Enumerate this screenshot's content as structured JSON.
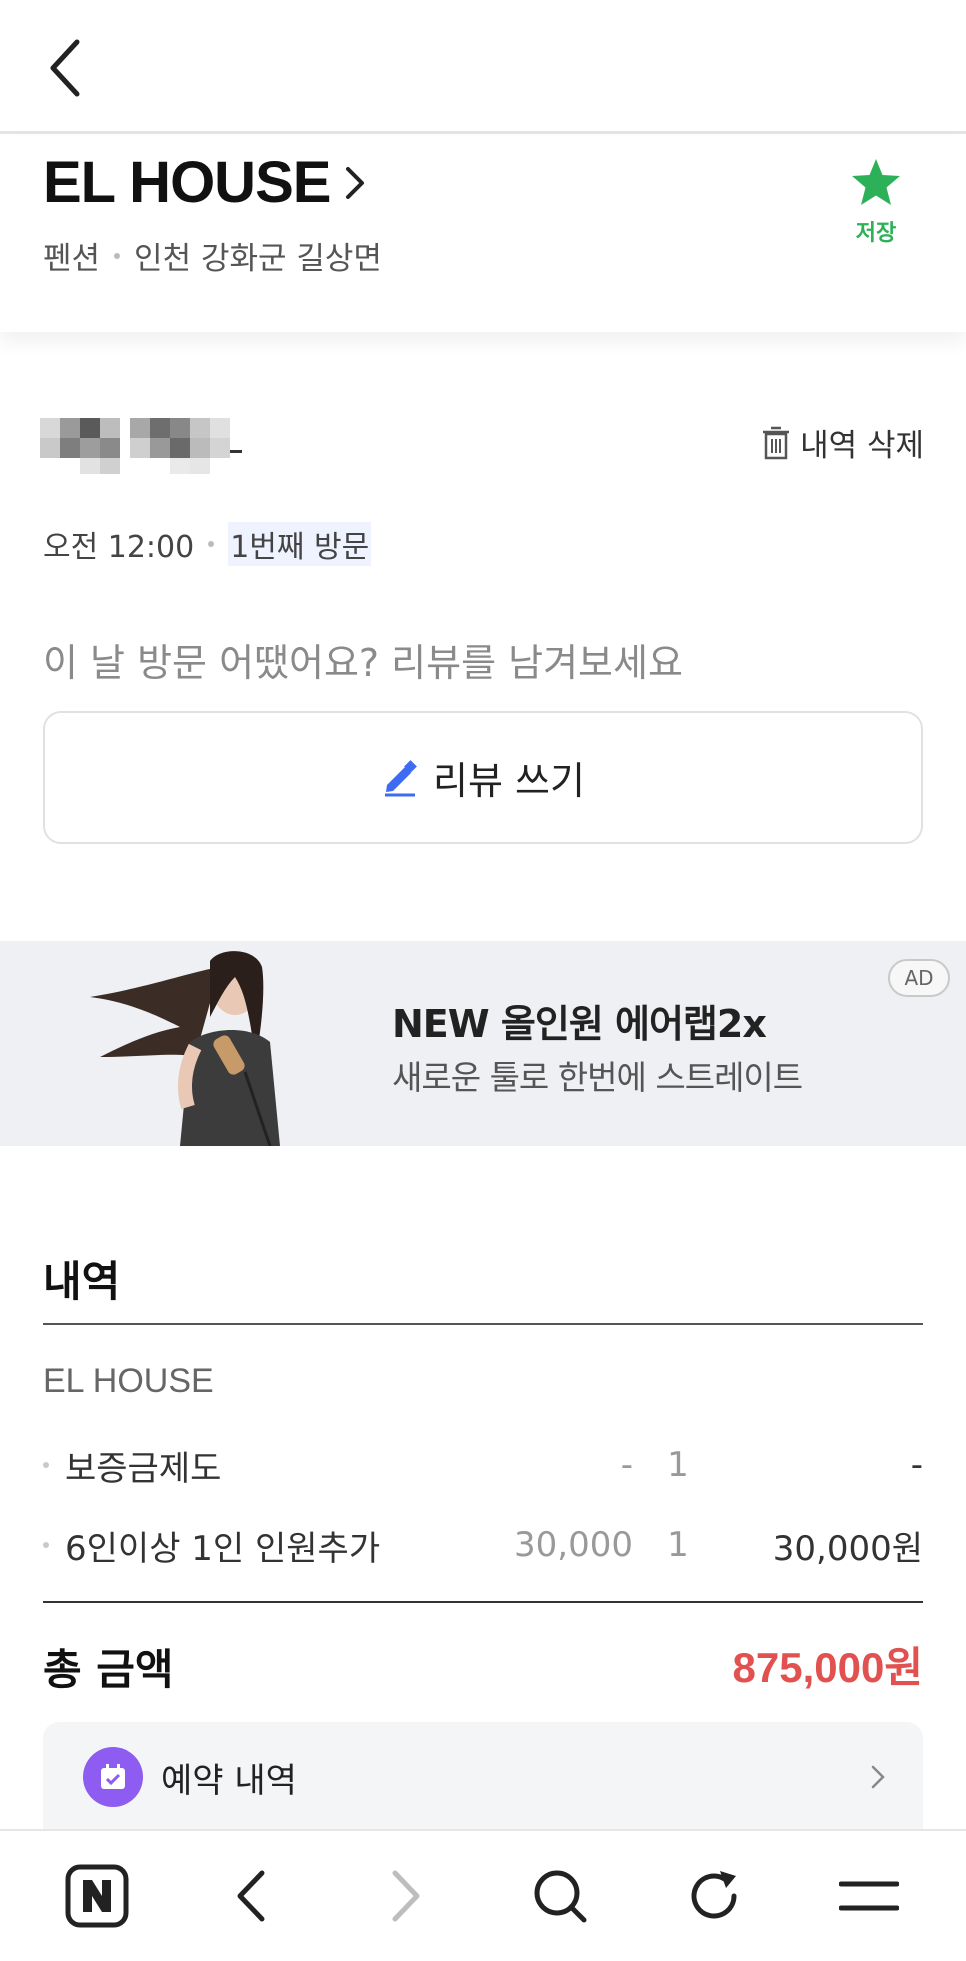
{
  "place": {
    "name": "EL HOUSE",
    "category": "펜션",
    "location": "인천 강화군 길상면",
    "save_label": "저장",
    "save_color": "#2db158"
  },
  "visit": {
    "delete_label": "내역 삭제",
    "time": "오전 12:00",
    "visit_count": "1번째 방문",
    "review_prompt": "이 날 방문 어땠어요? 리뷰를 남겨보세요",
    "review_button_label": "리뷰 쓰기"
  },
  "ad": {
    "title": "NEW 올인원 에어랩2x",
    "subtitle": "새로운 툴로 한번에 스트레이트",
    "badge": "AD"
  },
  "details": {
    "section_title": "내역",
    "vendor": "EL HOUSE",
    "items": [
      {
        "name": "보증금제도",
        "price": "-",
        "qty": "1",
        "total": "-"
      },
      {
        "name": "6인이상 1인 인원추가",
        "price": "30,000",
        "qty": "1",
        "total": "30,000원"
      }
    ],
    "total_label": "총 금액",
    "total_value": "875,000원",
    "total_color": "#e0514f"
  },
  "reservation": {
    "label": "예약 내역",
    "icon_color": "#8e5cf0"
  },
  "browser_bar": {
    "icons": [
      "naver-home-icon",
      "back-arrow-icon",
      "forward-arrow-icon",
      "search-icon",
      "refresh-icon",
      "menu-icon"
    ]
  }
}
